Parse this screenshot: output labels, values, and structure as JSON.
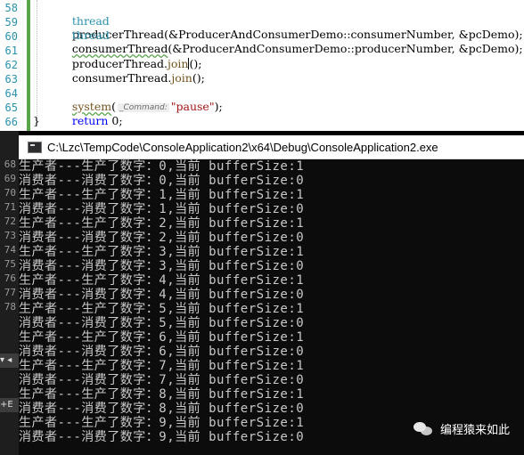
{
  "editor": {
    "line_numbers": [
      "58",
      "59",
      "60",
      "61",
      "62",
      "63",
      "64",
      "65",
      "66"
    ],
    "l58": {
      "kw": "thread",
      "name": "producerThread",
      "args": "(&ProducerAndConsumerDemo::consumerNumber, &pcDemo);"
    },
    "l59": {
      "kw": "thread",
      "name": "consumerThread",
      "args": "(&ProducerAndConsumerDemo::producerNumber, &pcDemo);"
    },
    "l61": {
      "obj": "producerThread.",
      "call": "join",
      "rest": "();"
    },
    "l62": {
      "obj": "consumerThread.",
      "call": "join",
      "rest": "();"
    },
    "l64": {
      "fn": "system",
      "hint": "_Command:",
      "arg": "\"pause\"",
      "rest": ");"
    },
    "l65": {
      "kw": "return",
      "rest": " 0;"
    },
    "l66": {
      "brace": "}"
    }
  },
  "console": {
    "title": "C:\\Lzc\\TempCode\\ConsoleApplication2\\x64\\Debug\\ConsoleApplication2.exe",
    "lines": [
      "生产者---生产了数字：0,当前 bufferSize:1",
      "消费者---消费了数字：0,当前 bufferSize:0",
      "生产者---生产了数字：1,当前 bufferSize:1",
      "消费者---消费了数字：1,当前 bufferSize:0",
      "生产者---生产了数字：2,当前 bufferSize:1",
      "消费者---消费了数字：2,当前 bufferSize:0",
      "生产者---生产了数字：3,当前 bufferSize:1",
      "消费者---消费了数字：3,当前 bufferSize:0",
      "生产者---生产了数字：4,当前 bufferSize:1",
      "消费者---消费了数字：4,当前 bufferSize:0",
      "生产者---生产了数字：5,当前 bufferSize:1",
      "消费者---消费了数字：5,当前 bufferSize:0",
      "生产者---生产了数字：6,当前 bufferSize:1",
      "消费者---消费了数字：6,当前 bufferSize:0",
      "生产者---生产了数字：7,当前 bufferSize:1",
      "消费者---消费了数字：7,当前 bufferSize:0",
      "生产者---生产了数字：8,当前 bufferSize:1",
      "消费者---消费了数字：8,当前 bufferSize:0",
      "生产者---生产了数字：9,当前 bufferSize:1",
      "消费者---消费了数字：9,当前 bufferSize:0"
    ]
  },
  "left_strip": {
    "line_numbers": [
      "68",
      "69",
      "70",
      "71",
      "72",
      "73",
      "74",
      "75",
      "76",
      "77",
      "78"
    ],
    "marker_a": "▾ ◂",
    "marker_b": "+E"
  },
  "watermark": {
    "text": "编程猿来如此"
  },
  "colors": {
    "keyword": "#0000ff",
    "type": "#2b91af",
    "string": "#a31515",
    "console_bg": "#0c0c0c"
  }
}
